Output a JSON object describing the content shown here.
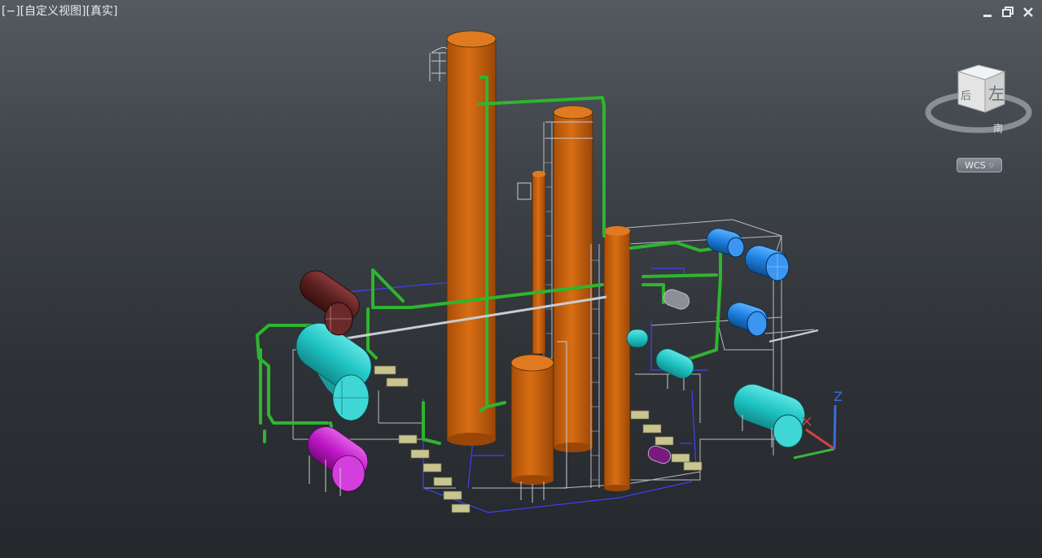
{
  "viewport": {
    "view_label_bracket_min": "[−]",
    "view_label_view": "[自定义视图]",
    "view_label_style": "[真实]"
  },
  "window_controls": {
    "minimize_icon": "minimize-icon",
    "restore_icon": "restore-icon",
    "close_icon": "close-icon"
  },
  "viewcube": {
    "face_label": "左",
    "side_label": "后",
    "compass_label": "南"
  },
  "ucs": {
    "z_label": "Z"
  },
  "wcs_menu": {
    "label": "WCS",
    "caret": "▽"
  },
  "colors": {
    "column_orange": "#c8620e",
    "pipe_green": "#2fb52f",
    "vessel_cyan": "#1fc4c4",
    "vessel_magenta": "#c018c8",
    "exchanger_blue": "#1e7fe0",
    "exchanger_brown": "#5a2020",
    "wire_blue": "#3a3aff",
    "wire_grey": "#b9bcc0"
  }
}
